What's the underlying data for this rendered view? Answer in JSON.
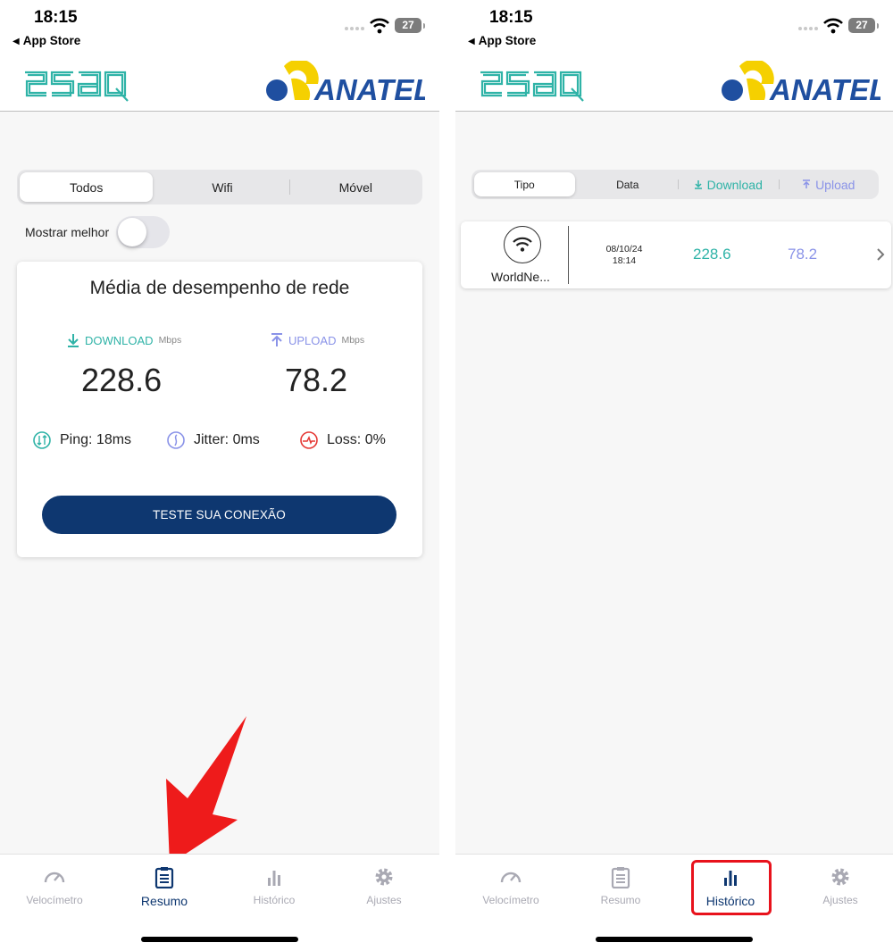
{
  "left": {
    "status": {
      "time": "18:15",
      "back": "App Store",
      "battery": "27"
    },
    "filters": [
      "Todos",
      "Wifi",
      "Móvel"
    ],
    "toggle_label": "Mostrar melhor",
    "card": {
      "title": "Média de desempenho de rede",
      "download_label": "DOWNLOAD",
      "upload_label": "UPLOAD",
      "unit": "Mbps",
      "download_value": "228.6",
      "upload_value": "78.2",
      "ping": "Ping: 18ms",
      "jitter": "Jitter: 0ms",
      "loss": "Loss: 0%",
      "cta": "TESTE SUA CONEXÃO"
    },
    "tabs": [
      "Velocímetro",
      "Resumo",
      "Histórico",
      "Ajustes"
    ],
    "active_tab": "Resumo"
  },
  "right": {
    "status": {
      "time": "18:15",
      "back": "App Store",
      "battery": "27"
    },
    "sort": [
      "Tipo",
      "Data",
      "Download",
      "Upload"
    ],
    "history": [
      {
        "network": "WorldNe...",
        "date": "08/10/24",
        "time": "18:14",
        "download": "228.6",
        "upload": "78.2"
      }
    ],
    "tabs": [
      "Velocímetro",
      "Resumo",
      "Histórico",
      "Ajustes"
    ],
    "active_tab": "Histórico"
  },
  "logos": {
    "esaq": "esaq",
    "anatel": "ANATEL"
  },
  "colors": {
    "teal": "#2fb3a7",
    "lavender": "#8a93e8",
    "navy": "#0e3770",
    "anatel_yellow": "#f5d000",
    "anatel_blue": "#1f4fa0",
    "highlight": "#e8121c"
  }
}
